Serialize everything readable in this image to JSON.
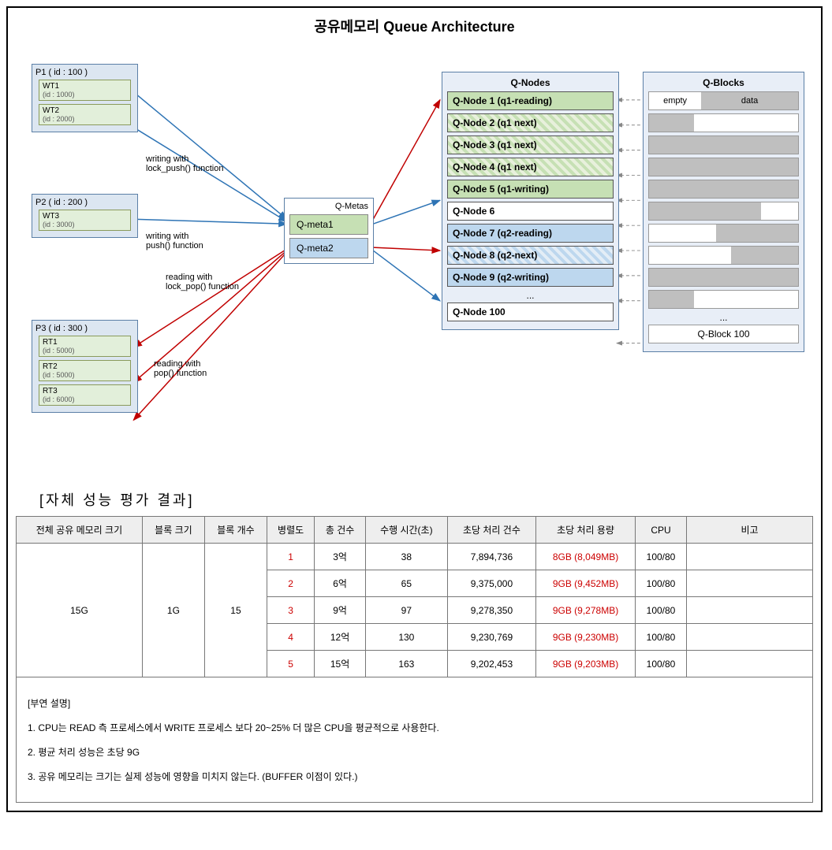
{
  "title": "공유메모리 Queue Architecture",
  "processes": {
    "p1": {
      "label": "P1 ( id : 100 )",
      "threads": [
        {
          "name": "WT1",
          "id": "(id : 1000)"
        },
        {
          "name": "WT2",
          "id": "(id : 2000)"
        }
      ]
    },
    "p2": {
      "label": "P2 ( id : 200 )",
      "threads": [
        {
          "name": "WT3",
          "id": "(id : 3000)"
        }
      ]
    },
    "p3": {
      "label": "P3 ( id : 300 )",
      "threads": [
        {
          "name": "RT1",
          "id": "(id : 5000)"
        },
        {
          "name": "RT2",
          "id": "(id : 5000)"
        },
        {
          "name": "RT3",
          "id": "(id : 6000)"
        }
      ]
    }
  },
  "annotations": {
    "a1": "writing with\nlock_push() function",
    "a2": "writing with\npush() function",
    "a3": "reading with\nlock_pop() function",
    "a4": "reading with\npop() function"
  },
  "qmetas": {
    "title": "Q-Metas",
    "items": [
      "Q-meta1",
      "Q-meta2"
    ]
  },
  "qnodes": {
    "title": "Q-Nodes",
    "items": [
      "Q-Node 1 (q1-reading)",
      "Q-Node 2 (q1 next)",
      "Q-Node 3 (q1 next)",
      "Q-Node 4 (q1 next)",
      "Q-Node 5 (q1-writing)",
      "Q-Node 6",
      "Q-Node 7 (q2-reading)",
      "Q-Node 8 (q2-next)",
      "Q-Node 9 (q2-writing)"
    ],
    "ellipsis": "...",
    "last": "Q-Node 100"
  },
  "qblocks": {
    "title": "Q-Blocks",
    "header_empty": "empty",
    "header_data": "data",
    "fills": [
      30,
      0,
      0,
      0,
      75,
      0,
      40,
      0,
      30
    ],
    "ellipsis": "...",
    "last": "Q-Block 100"
  },
  "section_title": "[자체 성능 평가 결과]",
  "table": {
    "headers": [
      "전체 공유 메모리 크기",
      "블록 크기",
      "블록 개수",
      "병렬도",
      "총 건수",
      "수행 시간(초)",
      "초당 처리 건수",
      "초당 처리 용량",
      "CPU",
      "비고"
    ],
    "rowspan_vals": {
      "total_mem": "15G",
      "block_size": "1G",
      "block_count": "15"
    },
    "rows": [
      {
        "parallel": "1",
        "total": "3억",
        "time": "38",
        "tps": "7,894,736",
        "thr": "8GB (8,049MB)",
        "cpu": "100/80",
        "note": ""
      },
      {
        "parallel": "2",
        "total": "6억",
        "time": "65",
        "tps": "9,375,000",
        "thr": "9GB (9,452MB)",
        "cpu": "100/80",
        "note": ""
      },
      {
        "parallel": "3",
        "total": "9억",
        "time": "97",
        "tps": "9,278,350",
        "thr": "9GB (9,278MB)",
        "cpu": "100/80",
        "note": ""
      },
      {
        "parallel": "4",
        "total": "12억",
        "time": "130",
        "tps": "9,230,769",
        "thr": "9GB (9,230MB)",
        "cpu": "100/80",
        "note": ""
      },
      {
        "parallel": "5",
        "total": "15억",
        "time": "163",
        "tps": "9,202,453",
        "thr": "9GB (9,203MB)",
        "cpu": "100/80",
        "note": ""
      }
    ]
  },
  "notes": {
    "title": "[부연 설명]",
    "items": [
      "1.  CPU는 READ 측 프로세스에서 WRITE 프로세스 보다 20~25% 더 많은 CPU을 평균적으로 사용한다.",
      "2.  평균 처리 성능은 초당 9G",
      "3.  공유 메모리는 크기는 실제 성능에 영향을 미치지 않는다. (BUFFER 이점이 있다.)"
    ]
  },
  "chart_data": {
    "type": "table",
    "title": "자체 성능 평가 결과",
    "columns": [
      "전체 공유 메모리 크기",
      "블록 크기",
      "블록 개수",
      "병렬도",
      "총 건수",
      "수행 시간(초)",
      "초당 처리 건수",
      "초당 처리 용량",
      "CPU"
    ],
    "rows": [
      [
        "15G",
        "1G",
        15,
        1,
        "3억",
        38,
        7894736,
        "8GB (8,049MB)",
        "100/80"
      ],
      [
        "15G",
        "1G",
        15,
        2,
        "6억",
        65,
        9375000,
        "9GB (9,452MB)",
        "100/80"
      ],
      [
        "15G",
        "1G",
        15,
        3,
        "9억",
        97,
        9278350,
        "9GB (9,278MB)",
        "100/80"
      ],
      [
        "15G",
        "1G",
        15,
        4,
        "12억",
        130,
        9230769,
        "9GB (9,230MB)",
        "100/80"
      ],
      [
        "15G",
        "1G",
        15,
        5,
        "15억",
        163,
        9202453,
        "9GB (9,203MB)",
        "100/80"
      ]
    ]
  }
}
